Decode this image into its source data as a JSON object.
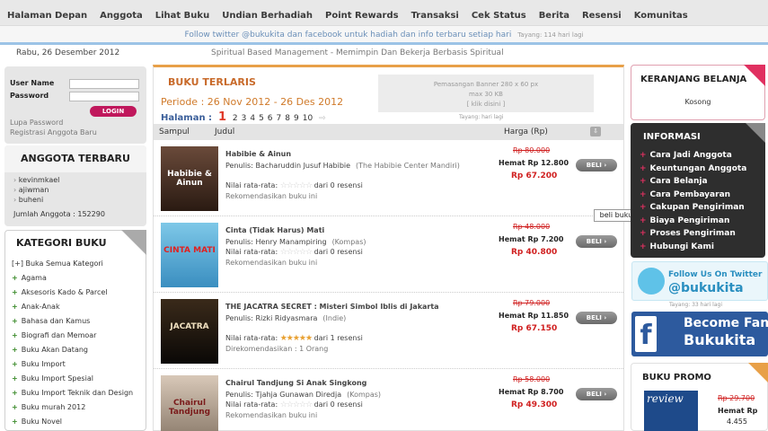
{
  "nav": {
    "items": [
      "Halaman Depan",
      "Anggota",
      "Lihat Buku",
      "Undian Berhadiah",
      "Point Rewards",
      "Transaksi",
      "Cek Status",
      "Berita",
      "Resensi",
      "Komunitas"
    ],
    "follow_text": "Follow twitter @bukukita dan facebook untuk hadiah dan info terbaru setiap hari",
    "follow_time": "Tayang: 114 hari lagi",
    "date": "Rabu, 26 Desember 2012",
    "slogan": "Spiritual Based Management - Memimpin Dan Bekerja Berbasis Spiritual"
  },
  "login": {
    "user_label": "User Name",
    "pass_label": "Password",
    "button": "LOGIN",
    "forgot": "Lupa Password",
    "register": "Registrasi Anggota Baru"
  },
  "members": {
    "title": "ANGGOTA TERBARU",
    "names": [
      "kevinmkael",
      "ajiwman",
      "buheni"
    ],
    "count": "Jumlah Anggota : 152290"
  },
  "categories": {
    "title": "KATEGORI BUKU",
    "all": "[+] Buka Semua Kategori",
    "items": [
      "Agama",
      "Aksesoris Kado & Parcel",
      "Anak-Anak",
      "Bahasa dan Kamus",
      "Biografi dan Memoar",
      "Buku Akan Datang",
      "Buku Import",
      "Buku Import Spesial",
      "Buku Import Teknik dan Design",
      "Buku murah 2012",
      "Buku Novel"
    ]
  },
  "main": {
    "title": "BUKU TERLARIS",
    "periode": "Periode : 26 Nov 2012 - 26 Des 2012",
    "halaman_label": "Halaman :",
    "current_page": "1",
    "pages": [
      "2",
      "3",
      "4",
      "5",
      "6",
      "7",
      "8",
      "9",
      "10"
    ],
    "banner_line1": "Pemasangan Banner 280 x 60 px",
    "banner_line2": "max 30 KB",
    "banner_line3": "[ klik disini ]",
    "banner_time": "Tayang: hari lagi",
    "col_cover": "Sampul",
    "col_title": "Judul",
    "col_price": "Harga (Rp)"
  },
  "books": [
    {
      "title": "Habibie & Ainun",
      "author": "Penulis: Bacharuddin Jusuf Habibie",
      "publisher": "(The Habibie Center Mandiri)",
      "rating_prefix": "Nilai rata-rata:",
      "stars_filled": 0,
      "rating_suffix": "dari 0 resensi",
      "recommend": "Rekomendasikan buku ini",
      "old_price": "Rp 80.000",
      "saving": "Hemat Rp 12.800",
      "price": "Rp 67.200",
      "button": "BELI",
      "cover_text": "Habibie & Ainun"
    },
    {
      "title": "Cinta (Tidak Harus) Mati",
      "author": "Penulis: Henry Manampiring",
      "publisher": "(Kompas)",
      "rating_prefix": "Nilai rata-rata:",
      "stars_filled": 0,
      "rating_suffix": "dari 0 resensi",
      "recommend": "Rekomendasikan buku ini",
      "old_price": "Rp 48.000",
      "saving": "Hemat Rp 7.200",
      "price": "Rp 40.800",
      "button": "BELI",
      "cover_text": "CINTA MATI"
    },
    {
      "title": "THE JACATRA SECRET : Misteri Simbol Iblis di Jakarta",
      "author": "Penulis: Rizki Ridyasmara",
      "publisher": "(Indie)",
      "rating_prefix": "Nilai rata-rata:",
      "stars_filled": 5,
      "rating_suffix": "dari 1 resensi",
      "recommend": "Direkomendasikan : 1 Orang",
      "old_price": "Rp 79.000",
      "saving": "Hemat Rp 11.850",
      "price": "Rp 67.150",
      "button": "BELI",
      "cover_text": "JACATRA"
    },
    {
      "title": "Chairul Tandjung Si Anak Singkong",
      "author": "Penulis: Tjahja Gunawan Diredja",
      "publisher": "(Kompas)",
      "rating_prefix": "Nilai rata-rata:",
      "stars_filled": 0,
      "rating_suffix": "dari 0 resensi",
      "recommend": "Rekomendasikan buku ini",
      "old_price": "Rp 58.000",
      "saving": "Hemat Rp 8.700",
      "price": "Rp 49.300",
      "button": "BELI",
      "cover_text": "Chairul Tandjung"
    }
  ],
  "tooltip": "beli buku ini",
  "cart": {
    "title": "KERANJANG BELANJA",
    "empty": "Kosong"
  },
  "info": {
    "title": "INFORMASI",
    "items": [
      "Cara Jadi Anggota",
      "Keuntungan Anggota",
      "Cara Belanja",
      "Cara Pembayaran",
      "Cakupan Pengiriman",
      "Biaya Pengiriman",
      "Proses Pengiriman",
      "Hubungi Kami"
    ]
  },
  "social": {
    "twitter_line1": "Follow Us On Twitter",
    "twitter_line2": "@bukukita",
    "twitter_time": "Tayang: 33 hari lagi",
    "fb_line1": "Become Fan",
    "fb_line2": "Bukukita"
  },
  "promo": {
    "title": "BUKU PROMO",
    "cover_text": "review",
    "old_price": "Rp 29.700",
    "saving": "Hemat Rp",
    "saving_value": "4.455"
  },
  "colors": {
    "accent_orange": "#c86a2a",
    "price_red": "#d02020",
    "login_pink": "#c0185c",
    "info_dark": "#2e2e2e",
    "facebook_blue": "#2d5a9e",
    "twitter_blue": "#2a8fc0"
  }
}
